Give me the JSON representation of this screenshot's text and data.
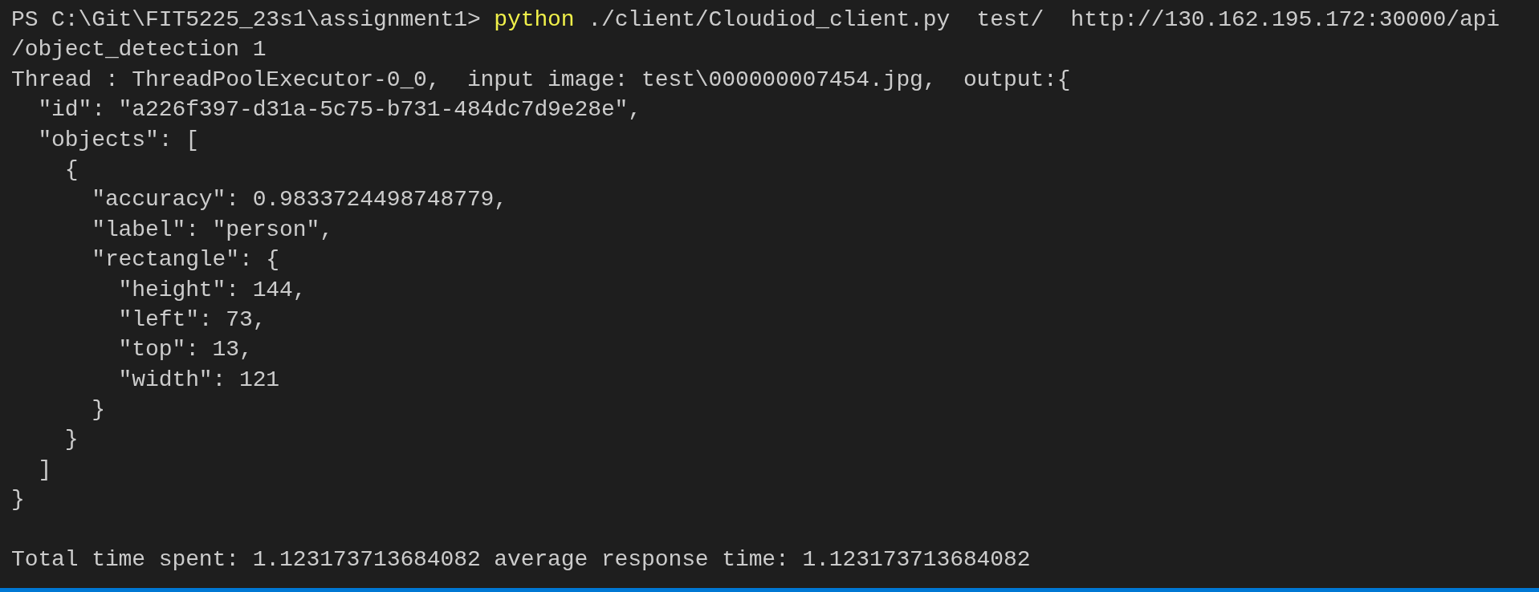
{
  "terminal": {
    "command_line": {
      "prompt": "PS C:\\Git\\FIT5225_23s1\\assignment1>",
      "command": "python",
      "arguments": "./client/Cloudiod_client.py  test/  http://130.162.195.172:30000/api"
    },
    "output_lines": [
      "/object_detection 1",
      "Thread : ThreadPoolExecutor-0_0,  input image: test\\000000007454.jpg,  output:{",
      "  \"id\": \"a226f397-d31a-5c75-b731-484dc7d9e28e\",",
      "  \"objects\": [",
      "    {",
      "      \"accuracy\": 0.9833724498748779,",
      "      \"label\": \"person\",",
      "      \"rectangle\": {",
      "        \"height\": 144,",
      "        \"left\": 73,",
      "        \"top\": 13,",
      "        \"width\": 121",
      "      }",
      "    }",
      "  ]",
      "}"
    ],
    "summary": "Total time spent: 1.123173713684082 average response time: 1.123173713684082"
  }
}
